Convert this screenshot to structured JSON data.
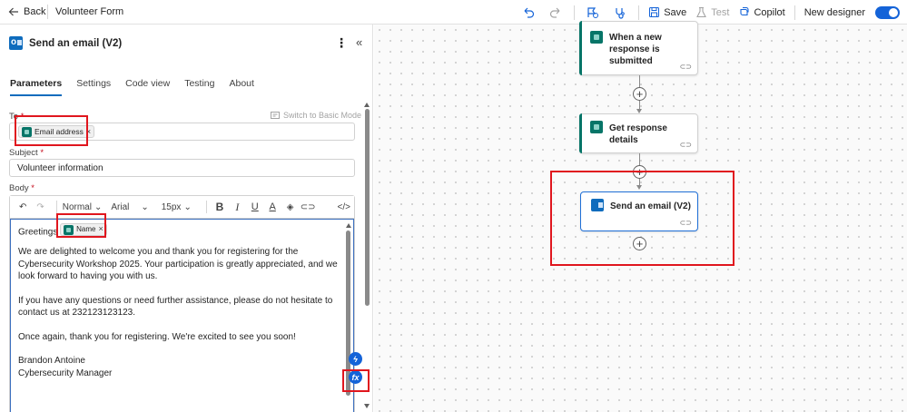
{
  "topbar": {
    "back_label": "Back",
    "title": "Volunteer Form",
    "save_label": "Save",
    "test_label": "Test",
    "copilot_label": "Copilot",
    "new_designer_label": "New designer",
    "new_designer_on": true
  },
  "panel": {
    "title": "Send an email (V2)",
    "tabs": [
      {
        "label": "Parameters"
      },
      {
        "label": "Settings"
      },
      {
        "label": "Code view"
      },
      {
        "label": "Testing"
      },
      {
        "label": "About"
      }
    ],
    "switch_basic_label": "Switch to Basic Mode",
    "to_label": "To",
    "to_token": "Email address",
    "subject_label": "Subject",
    "subject_value": "Volunteer information",
    "body_label": "Body",
    "editor": {
      "font": "Normal",
      "family": "Arial",
      "size": "15px",
      "greeting": "Greetings",
      "name_token": "Name",
      "paragraphs": [
        "We are delighted to welcome you and thank you for registering for the\nCybersecurity Workshop 2025. Your participation is greatly appreciated, and we\nlook forward to having you with us.",
        "If you have any questions or need further assistance, please do not hesitate to\ncontact us at 232123123123.",
        "Once again, thank you for registering. We're excited to see you soon!",
        "Brandon Antoine\nCybersecurity Manager"
      ]
    }
  },
  "canvas": {
    "nodes": [
      {
        "title": "When a new response is submitted"
      },
      {
        "title": "Get response details"
      },
      {
        "title": "Send an email (V2)"
      }
    ]
  },
  "colors": {
    "accent": "#0f6cbd",
    "forms": "#077568",
    "highlight": "#e0161e"
  }
}
